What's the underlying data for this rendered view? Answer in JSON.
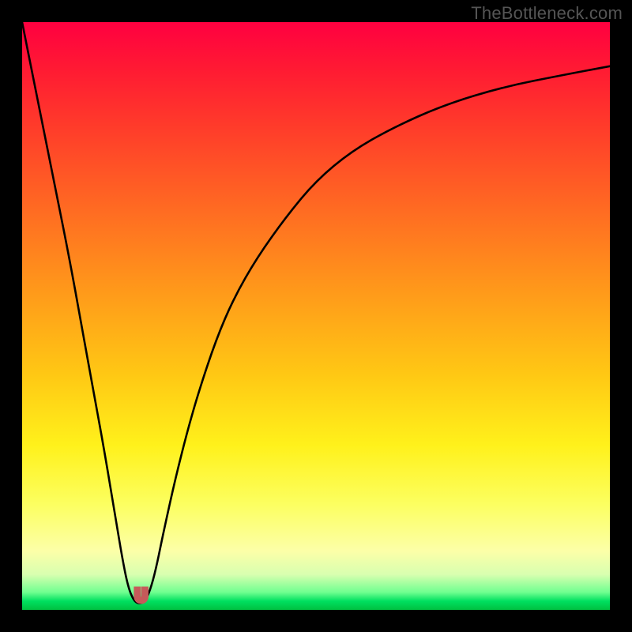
{
  "watermark": "TheBottleneck.com",
  "chart_data": {
    "type": "line",
    "title": "",
    "xlabel": "",
    "ylabel": "",
    "xlim": [
      0,
      100
    ],
    "ylim": [
      0,
      100
    ],
    "grid": false,
    "legend": false,
    "background_gradient": {
      "direction": "vertical",
      "stops": [
        {
          "pos": 0.0,
          "color": "#ff0040",
          "meaning": "worst"
        },
        {
          "pos": 0.5,
          "color": "#ffb020"
        },
        {
          "pos": 0.8,
          "color": "#fff24a"
        },
        {
          "pos": 0.97,
          "color": "#70ff90"
        },
        {
          "pos": 1.0,
          "color": "#00c040",
          "meaning": "best"
        }
      ]
    },
    "series": [
      {
        "name": "bottleneck-curve",
        "x": [
          0,
          2,
          4,
          6,
          8,
          10,
          12,
          14,
          16,
          17,
          18,
          19,
          20,
          21,
          22,
          23,
          24,
          26,
          28,
          30,
          33,
          36,
          40,
          45,
          50,
          56,
          63,
          72,
          82,
          92,
          100
        ],
        "y": [
          100,
          90,
          80,
          70,
          60,
          49,
          38,
          27,
          15,
          9,
          4,
          1.5,
          1,
          1.5,
          4,
          8,
          13,
          22,
          30,
          37,
          46,
          53,
          60,
          67,
          73,
          78,
          82,
          86,
          89,
          91,
          92.5
        ]
      }
    ],
    "marker": {
      "name": "bottleneck-minimum",
      "shape": "u",
      "color": "#c65a5a",
      "x_range": [
        19,
        21.5
      ],
      "y": 1
    }
  }
}
